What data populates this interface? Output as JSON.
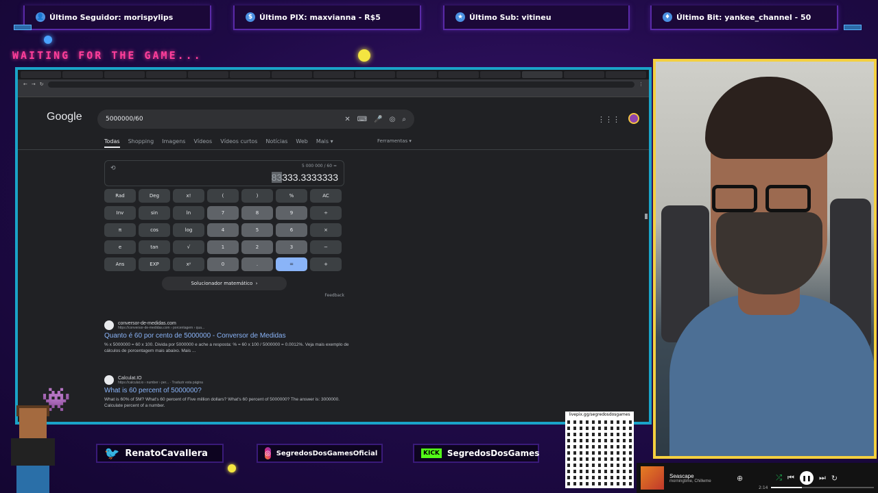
{
  "alerts": {
    "follower": "Último Seguidor: morispylips",
    "pix": "Último PIX: maxvianna - R$5",
    "sub": "Último Sub: vitineu",
    "bit": "Último Bit: yankee_channel - 50"
  },
  "waiting_text": "WAITING FOR THE GAME...",
  "colors": {
    "accent_cyan": "#1aa3c8",
    "cam_border": "#f4d03f",
    "waiting_pink": "#ff3e9a",
    "link_blue": "#8ab4f8"
  },
  "google": {
    "logo": "Google",
    "query": "5000000/60",
    "tabs": [
      "Todas",
      "Shopping",
      "Imagens",
      "Vídeos",
      "Vídeos curtos",
      "Notícias",
      "Web",
      "Mais"
    ],
    "tools": "Ferramentas",
    "calculator": {
      "expression": "5 000 000 / 60 =",
      "result_selected": "83",
      "result_rest": "333.3333333",
      "keys": [
        "Rad",
        "Deg",
        "x!",
        "(",
        ")",
        "%",
        "AC",
        "Inv",
        "sin",
        "ln",
        "7",
        "8",
        "9",
        "÷",
        "π",
        "cos",
        "log",
        "4",
        "5",
        "6",
        "×",
        "e",
        "tan",
        "√",
        "1",
        "2",
        "3",
        "−",
        "Ans",
        "EXP",
        "xʸ",
        "0",
        ".",
        "=",
        "+"
      ],
      "solver": "Solucionador matemático",
      "feedback": "Feedback"
    },
    "results": [
      {
        "site": "conversor-de-medidas.com",
        "path": "https://conversor-de-medidas.com › porcentagem › qua...",
        "title": "Quanto é 60 por cento de 5000000 - Conversor de Medidas",
        "snippet": "% x 5000000 = 60 x 100. Divida por 5000000 e ache a resposta: % = 60 x 100 / 5000000 = 0.0012%. Veja mais exemplo de cálculos de porcentagem mais abaixo. Mais ..."
      },
      {
        "site": "Calculat.IO",
        "path": "https://calculat.io › number › per... · Traduzir esta página",
        "title": "What is 60 percent of 5000000?",
        "snippet": "What is 60% of 5M? What's 60 percent of Five million dollars? What's 60 percent of 5000000? The answer is: 3000000. Calculate percent of a number."
      }
    ]
  },
  "social": {
    "twitter": "RenatoCavallera",
    "instagram": "SegredosDosGamesOficial",
    "kick_label": "KICK",
    "kick": "SegredosDosGames",
    "qr_label": "livepix.gg/segredosdosgames"
  },
  "player": {
    "title": "Seascape",
    "artist": "morningtime, Chillwme",
    "time": "2:14",
    "progress": 0.3
  }
}
